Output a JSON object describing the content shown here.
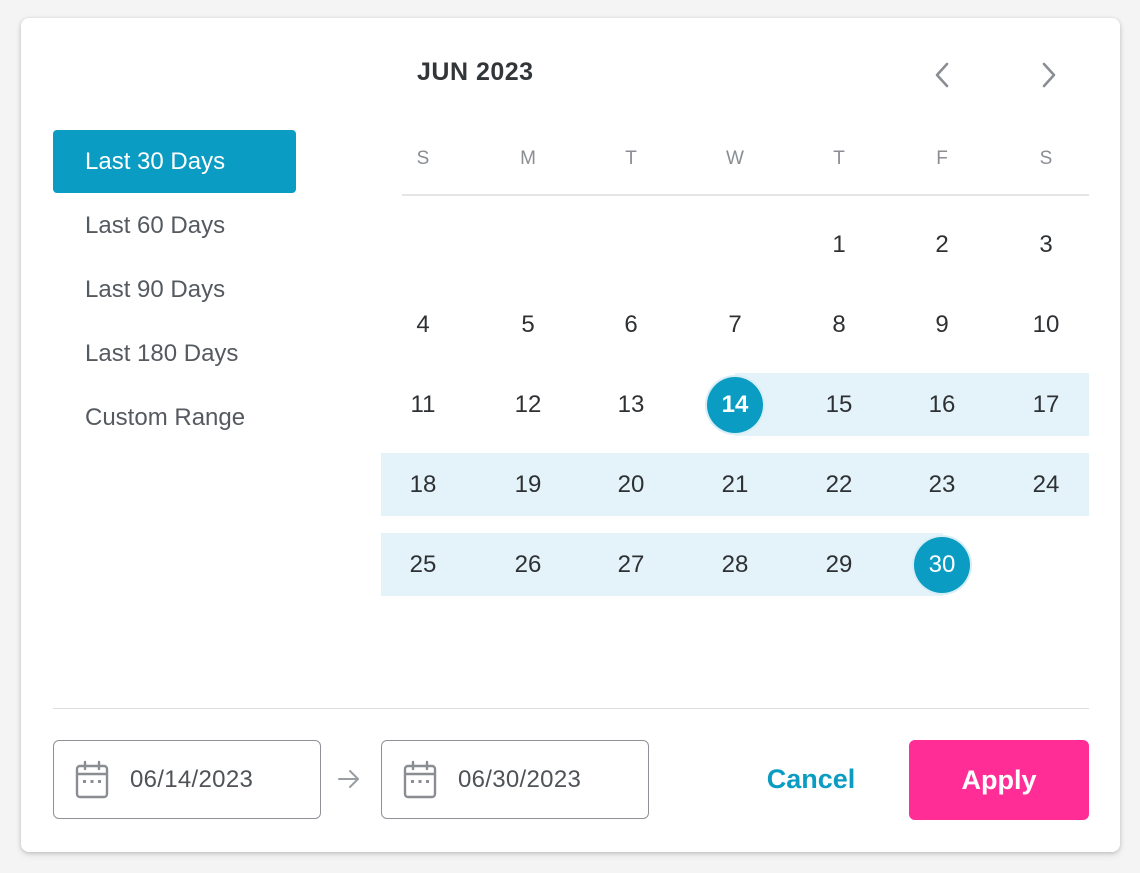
{
  "presets": [
    {
      "label": "Last 30 Days",
      "active": true
    },
    {
      "label": "Last 60 Days",
      "active": false
    },
    {
      "label": "Last 90 Days",
      "active": false
    },
    {
      "label": "Last 180 Days",
      "active": false
    },
    {
      "label": "Custom Range",
      "active": false
    }
  ],
  "calendar": {
    "month_title": "JUN 2023",
    "weekdays": [
      "S",
      "M",
      "T",
      "W",
      "T",
      "F",
      "S"
    ],
    "rows": [
      [
        "",
        "",
        "",
        "",
        "1",
        "2",
        "3"
      ],
      [
        "4",
        "5",
        "6",
        "7",
        "8",
        "9",
        "10"
      ],
      [
        "11",
        "12",
        "13",
        "14",
        "15",
        "16",
        "17"
      ],
      [
        "18",
        "19",
        "20",
        "21",
        "22",
        "23",
        "24"
      ],
      [
        "25",
        "26",
        "27",
        "28",
        "29",
        "30",
        ""
      ]
    ],
    "range_start": "14",
    "range_end": "30"
  },
  "footer": {
    "start_date": "06/14/2023",
    "end_date": "06/30/2023",
    "cancel_label": "Cancel",
    "apply_label": "Apply"
  },
  "icons": {
    "prev": "chevron-left-icon",
    "next": "chevron-right-icon",
    "calendar": "calendar-icon",
    "arrow": "arrow-right-icon"
  },
  "colors": {
    "accent": "#0a9cc2",
    "range_fill": "#e4f3f9",
    "apply": "#ff2d95"
  }
}
